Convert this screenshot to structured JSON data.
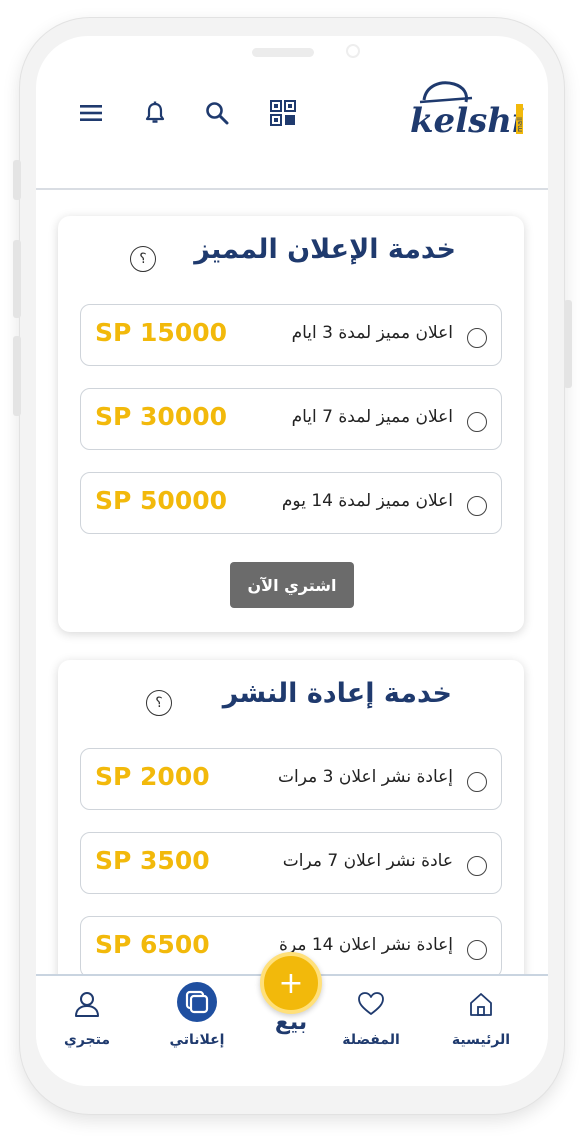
{
  "header": {
    "logo_text": "kelshi",
    "logo_sub": "mall"
  },
  "featured_service": {
    "title": "خدمة الإعلان المميز",
    "help": "؟",
    "options": [
      {
        "label": "اعلان مميز لمدة 3 ايام",
        "price": "SP 15000"
      },
      {
        "label": "اعلان مميز لمدة 7 ايام",
        "price": "SP 30000"
      },
      {
        "label": "اعلان مميز لمدة 14 يوم",
        "price": "SP 50000"
      }
    ],
    "buy_label": "اشتري الآن"
  },
  "republish_service": {
    "title": "خدمة إعادة النشر",
    "help": "؟",
    "options": [
      {
        "label": "إعادة نشر اعلان 3 مرات",
        "price": "SP 2000"
      },
      {
        "label": "عادة نشر اعلان 7 مرات",
        "price": "SP 3500"
      },
      {
        "label": "إعادة نشر اعلان 14 مرة",
        "price": "SP 6500"
      }
    ]
  },
  "bottom_nav": {
    "store": "متجري",
    "my_ads": "إعلاناتي",
    "sell": "بيع",
    "sell_icon": "+",
    "favorites": "المفضلة",
    "home": "الرئيسية"
  },
  "colors": {
    "primary": "#1f3a6e",
    "accent": "#f2b90b",
    "button": "#6b6b6b"
  }
}
